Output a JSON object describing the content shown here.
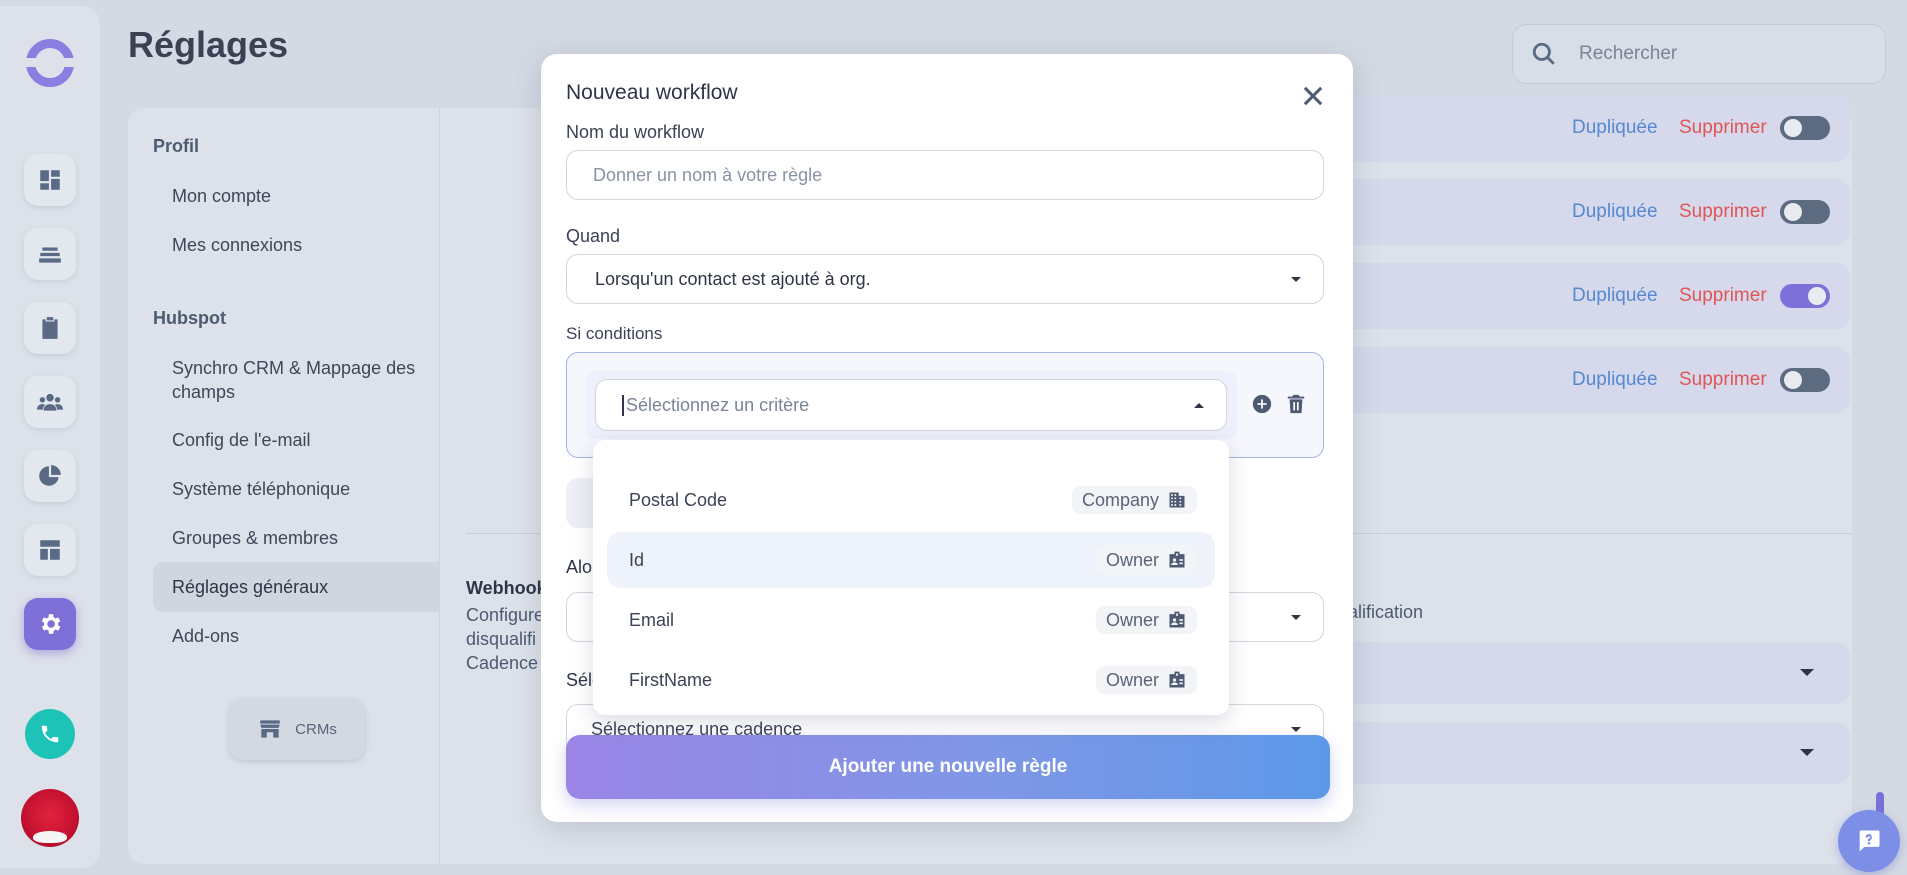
{
  "header": {
    "title": "Réglages",
    "search_placeholder": "Rechercher"
  },
  "settings_nav": {
    "section_profile": "Profil",
    "profile_items": [
      "Mon compte",
      "Mes connexions"
    ],
    "section_hubspot": "Hubspot",
    "hubspot_items": [
      "Synchro CRM & Mappage des champs",
      "Config de l'e-mail",
      "Système téléphonique",
      "Groupes & membres",
      "Réglages généraux",
      "Add-ons"
    ],
    "active_item": "Réglages généraux",
    "crms_button": "CRMs"
  },
  "workflow_rows": [
    {
      "duplicate": "Dupliquée",
      "delete": "Supprimer",
      "enabled": false
    },
    {
      "duplicate": "Dupliquée",
      "delete": "Supprimer",
      "enabled": false
    },
    {
      "duplicate": "Dupliquée",
      "delete": "Supprimer",
      "enabled": true
    },
    {
      "duplicate": "Dupliquée",
      "delete": "Supprimer",
      "enabled": false
    }
  ],
  "background_section": {
    "webhook_title": "Webhook",
    "webhook_desc_lines": [
      "Configure",
      "disqualifi",
      "Cadence"
    ],
    "webhook_tail": "ualification"
  },
  "modal": {
    "title": "Nouveau workflow",
    "name_label": "Nom du workflow",
    "name_placeholder": "Donner un nom à votre règle",
    "when_label": "Quand",
    "when_value": "Lorsqu'un contact est ajouté à org.",
    "conditions_label": "Si conditions",
    "criteria_placeholder": "Sélectionnez un critère",
    "then_label_partial": "Alo",
    "select_label_partial": "Séle",
    "cadence_placeholder": "Sélectionnez une cadence",
    "submit_button": "Ajouter une nouvelle règle"
  },
  "dropdown": {
    "options": [
      {
        "label": "Postal Code",
        "tag": "Company",
        "icon": "building-icon"
      },
      {
        "label": "Id",
        "tag": "Owner",
        "icon": "badge-icon",
        "hovered": true
      },
      {
        "label": "Email",
        "tag": "Owner",
        "icon": "badge-icon"
      },
      {
        "label": "FirstName",
        "tag": "Owner",
        "icon": "badge-icon"
      }
    ]
  },
  "colors": {
    "accent": "#7e70d8",
    "link_blue": "#5588d0",
    "danger_red": "#e05555",
    "phone_teal": "#1ec3b8"
  }
}
